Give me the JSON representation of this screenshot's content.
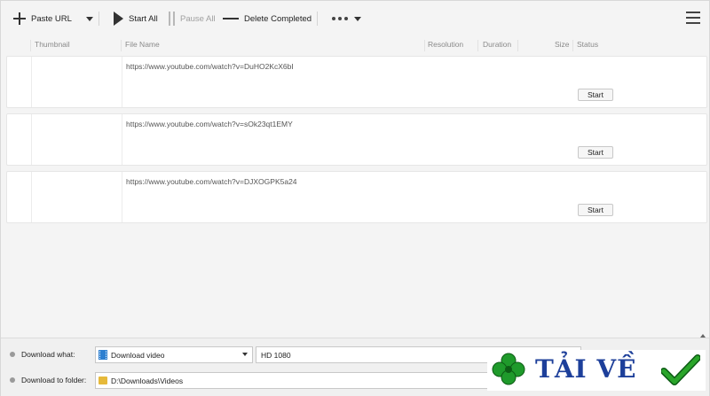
{
  "toolbar": {
    "paste_url": "Paste URL",
    "start_all": "Start All",
    "pause_all": "Pause All",
    "delete_completed": "Delete Completed"
  },
  "columns": {
    "thumbnail": "Thumbnail",
    "file_name": "File Name",
    "resolution": "Resolution",
    "duration": "Duration",
    "size": "Size",
    "status": "Status"
  },
  "rows": [
    {
      "url": "https://www.youtube.com/watch?v=DuHO2KcX6bI",
      "action": "Start"
    },
    {
      "url": "https://www.youtube.com/watch?v=sOk23qt1EMY",
      "action": "Start"
    },
    {
      "url": "https://www.youtube.com/watch?v=DJXOGPK5a24",
      "action": "Start"
    }
  ],
  "bottom": {
    "download_what_label": "Download what:",
    "download_what_value": "Download video",
    "quality_value": "HD 1080",
    "download_to_label": "Download to folder:",
    "download_to_value": "D:\\Downloads\\Videos"
  },
  "watermark": {
    "text": "TẢI VỀ"
  },
  "colors": {
    "accent": "#1d3f9a",
    "clover": "#1f9a2b",
    "check": "#2aa52a"
  }
}
